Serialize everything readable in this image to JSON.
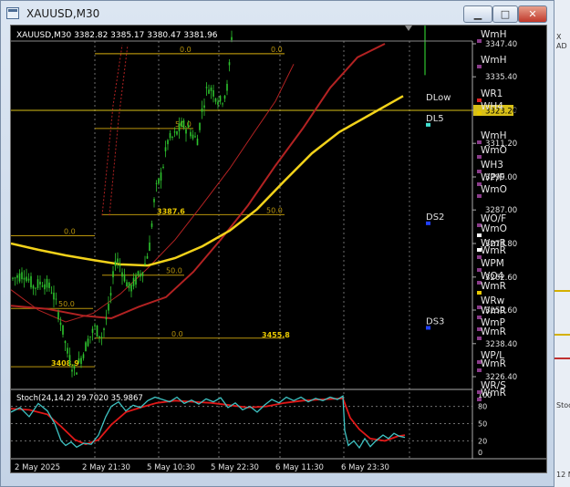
{
  "window": {
    "title": "XAUUSD,M30",
    "buttons": {
      "minimize": "▁",
      "maximize": "□",
      "close": "✕"
    }
  },
  "chart": {
    "header": "XAUUSD,M30  3382.82 3385.17 3380.47 3381.96",
    "symbol": "XAUUSD,M30",
    "ohlc": [
      "3382.82",
      "3385.17",
      "3380.47",
      "3381.96"
    ],
    "colors": {
      "background": "#000000",
      "candle": "#2ec52e",
      "ma_yellow": "#f2d21a",
      "ma_red": "#b22222",
      "fib": "#b8940c",
      "stoch_main": "#3ec3c3",
      "stoch_signal": "#e01818",
      "pivot": "#e6e6e6"
    },
    "price_axis": [
      "3347.40",
      "3335.40",
      "3323.20",
      "3311.20",
      "3299.00",
      "3287.00",
      "3274.80",
      "3262.60",
      "3250.60",
      "3238.40",
      "3226.40"
    ],
    "current_price_label": "3323.20",
    "time_axis": [
      "2 May 2025",
      "2 May 21:30",
      "5 May 10:30",
      "5 May 22:30",
      "6 May 11:30",
      "6 May 23:30"
    ],
    "fib_labels": [
      {
        "text": "0.0",
        "level": 3343.8
      },
      {
        "text": "0.0",
        "level": 3343.8
      },
      {
        "text": "50.0",
        "level": 3316.6
      },
      {
        "text": "50.0",
        "level": 3285.3
      },
      {
        "text": "0.0",
        "level": 3277.6
      },
      {
        "text": "50.0",
        "level": 3263.3
      },
      {
        "text": "50.0",
        "level": 3251.2
      },
      {
        "text": "0.0",
        "level": 3240.4
      }
    ],
    "price_tags": [
      {
        "text": "3387.6",
        "level": 3285.3
      },
      {
        "text": "3455.8",
        "level": 3240.4
      },
      {
        "text": "3408.9",
        "level": 3230.0
      }
    ],
    "levels": [
      {
        "text": "DLow",
        "level": 3326.5
      },
      {
        "text": "DL5",
        "level": 3320.6
      },
      {
        "text": "DS2",
        "level": 3284.8
      },
      {
        "text": "DS3",
        "level": 3246.8
      }
    ],
    "pivot_labels": [
      "WmH",
      "WmH",
      "WR1",
      "WH4",
      "WmH",
      "WmO",
      "WH3",
      "WP/F",
      "WmO",
      "WO/F",
      "WmO",
      "WmR",
      "WmR",
      "WPM",
      "WO4",
      "WmR",
      "WRw",
      "WmR",
      "WmP",
      "WmR",
      "WP/L",
      "WmR",
      "WR/S",
      "WmR"
    ],
    "stoch": {
      "label": "Stoch(24,14,2) 29.7020 35.9867",
      "scale": [
        "100",
        "80",
        "50",
        "20",
        "0"
      ]
    }
  },
  "side_panel": {
    "texts": [
      "X",
      "AD",
      "Stoc",
      "12 M"
    ]
  }
}
